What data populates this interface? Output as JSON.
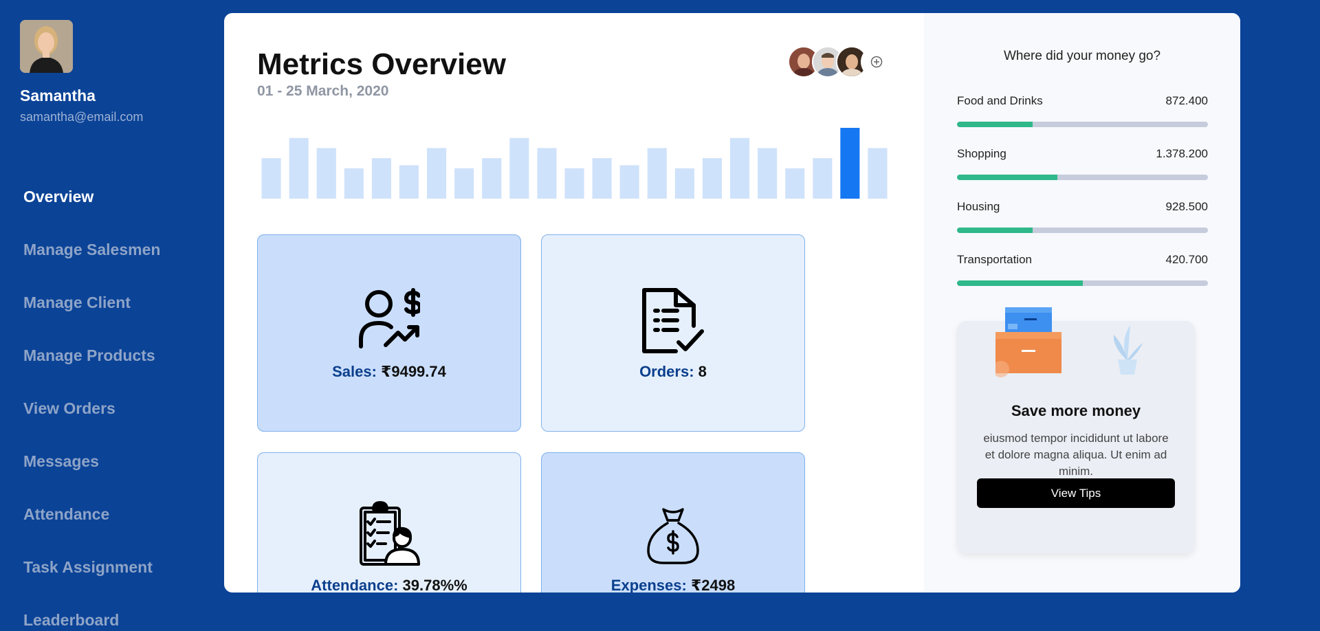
{
  "user": {
    "name": "Samantha",
    "email": "samantha@email.com"
  },
  "nav": {
    "items": [
      {
        "label": "Overview",
        "active": true
      },
      {
        "label": "Manage Salesmen"
      },
      {
        "label": "Manage Client"
      },
      {
        "label": "Manage Products"
      },
      {
        "label": "View Orders"
      },
      {
        "label": "Messages"
      },
      {
        "label": "Attendance"
      },
      {
        "label": "Task Assignment"
      },
      {
        "label": "Leaderboard"
      }
    ]
  },
  "header": {
    "title": "Metrics Overview",
    "date_range": "01 - 25 March, 2020"
  },
  "colors": {
    "sidebar": "#0b4397",
    "bar": "#cfe2fb",
    "bar_highlight": "#1677f2",
    "progress": "#2fb889",
    "track": "#c6ccdc"
  },
  "chart_data": {
    "type": "bar",
    "values": [
      4,
      6,
      5,
      3,
      4,
      3.3,
      5,
      3,
      4,
      6,
      5,
      3,
      4,
      3.3,
      5,
      3,
      4,
      6,
      5,
      3,
      4,
      7,
      5
    ],
    "highlight_index": 21
  },
  "metrics": {
    "sales": {
      "label": "Sales:",
      "value": "₹9499.74",
      "icon": "salesman-icon"
    },
    "orders": {
      "label": "Orders:",
      "value": "8",
      "icon": "document-check-icon"
    },
    "attendance": {
      "label": "Attendance:",
      "value": "39.78%%",
      "icon": "clipboard-person-icon"
    },
    "expenses": {
      "label": "Expenses:",
      "value": "₹2498",
      "icon": "money-bag-icon"
    }
  },
  "spending": {
    "title": "Where did your money go?",
    "categories": [
      {
        "name": "Food and Drinks",
        "amount": "872.400",
        "fraction": 0.3
      },
      {
        "name": "Shopping",
        "amount": "1.378.200",
        "fraction": 0.4
      },
      {
        "name": "Housing",
        "amount": "928.500",
        "fraction": 0.3
      },
      {
        "name": "Transportation",
        "amount": "420.700",
        "fraction": 0.5
      }
    ]
  },
  "tips": {
    "title": "Save more money",
    "text": "eiusmod tempor incididunt ut labore et dolore magna aliqua. Ut enim ad minim.",
    "button": "View Tips"
  }
}
